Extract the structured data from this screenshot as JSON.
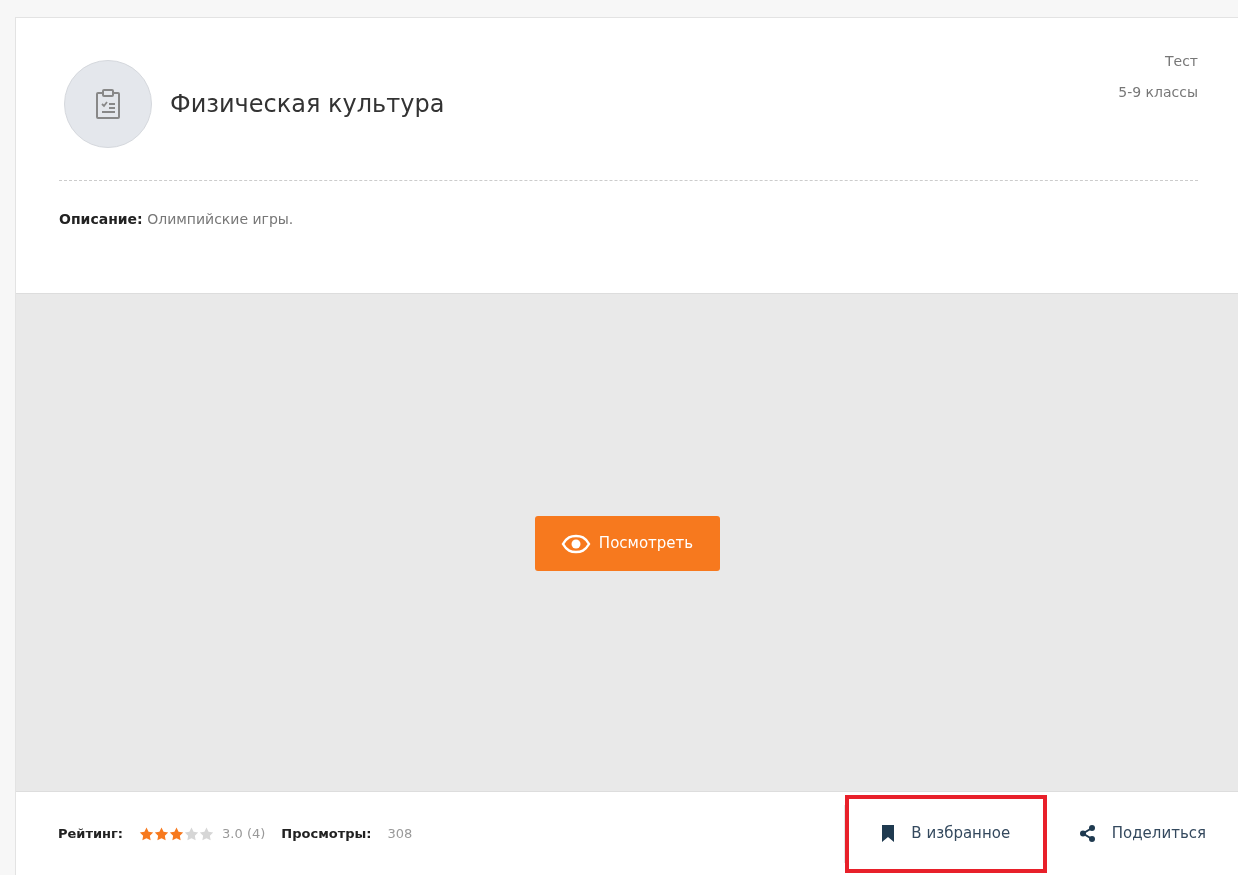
{
  "material": {
    "title": "Физическая культура",
    "type": "Тест",
    "grades": "5-9 классы",
    "description_label": "Описание:",
    "description": "Олимпийские игры."
  },
  "preview": {
    "button": "Посмотреть"
  },
  "footer": {
    "rating_label": "Рейтинг:",
    "stars": 3,
    "rating_value": "3.0 (4)",
    "views_label": "Просмотры:",
    "views": "308",
    "actions": [
      {
        "kind": "bookmark",
        "label": "В избранное",
        "highlighted": true
      },
      {
        "kind": "share",
        "label": "Поделиться",
        "highlighted": false
      }
    ]
  }
}
